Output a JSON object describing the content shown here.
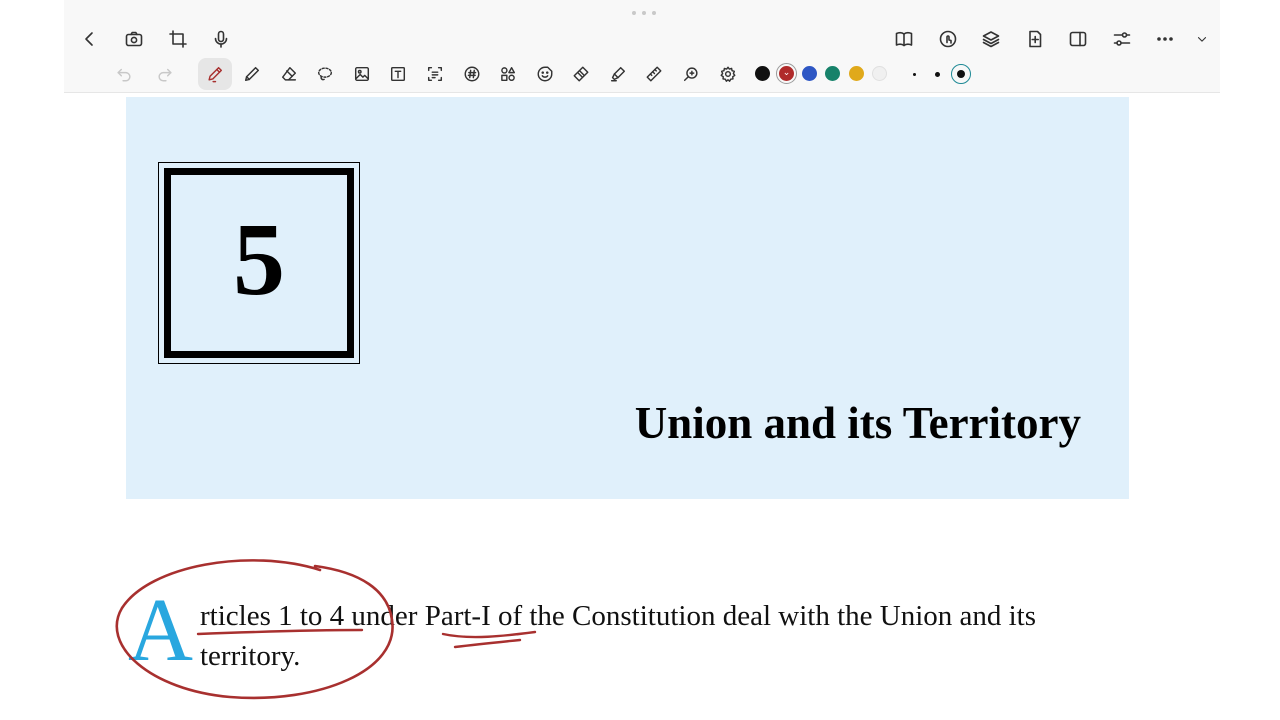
{
  "colors": {
    "accent_ink": "#a8302f",
    "dropcap": "#29a7df",
    "banner_bg": "#e0f0fb",
    "swatches": [
      "#111111",
      "#b02a2a",
      "#2e57c4",
      "#17826a",
      "#e0a91b",
      "#e8e8e8"
    ]
  },
  "toolbar": {
    "top_left_icons": [
      "back-icon",
      "camera-icon",
      "crop-icon",
      "microphone-icon"
    ],
    "top_right_icons": [
      "book-icon",
      "touch-icon",
      "layers-icon",
      "add-page-icon",
      "sidebar-icon",
      "adjust-icon",
      "more-icon",
      "chevron-down-icon"
    ],
    "tools": [
      "undo-icon",
      "redo-icon",
      "pen-icon",
      "pencil-icon",
      "eraser-icon",
      "lasso-icon",
      "image-icon",
      "text-box-icon",
      "scan-text-icon",
      "hashtag-icon",
      "shapes-icon",
      "sticker-icon",
      "tape-icon",
      "highlighter-icon",
      "ruler-icon",
      "zoom-icon",
      "settings-icon"
    ],
    "selected_tool": "pen",
    "selected_color": "#b02a2a",
    "stroke_sizes": [
      "small",
      "medium",
      "large"
    ],
    "selected_stroke_size": "large"
  },
  "document": {
    "chapter_number": "5",
    "chapter_title": "Union and its Territory",
    "dropcap": "A",
    "line1": "rticles 1 to 4 under Part-I of the Constitution deal with the Union and its",
    "line2": "territory."
  }
}
